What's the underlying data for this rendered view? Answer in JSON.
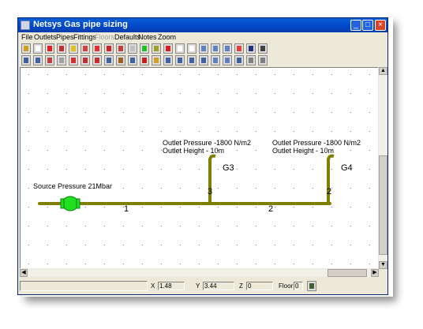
{
  "window": {
    "title": "Netsys Gas pipe sizing",
    "controls": {
      "minimize": "_",
      "maximize": "□",
      "close": "×"
    }
  },
  "menu": {
    "items": [
      {
        "label": "File",
        "enabled": true
      },
      {
        "label": "Outlets",
        "enabled": true
      },
      {
        "label": "Pipes",
        "enabled": true
      },
      {
        "label": "Fittings",
        "enabled": true
      },
      {
        "label": "Floors",
        "enabled": false
      },
      {
        "label": "Defaults",
        "enabled": true
      },
      {
        "label": "Notes",
        "enabled": true
      },
      {
        "label": "Zoom",
        "enabled": true
      }
    ]
  },
  "toolbar1": [
    {
      "icon": "pointer-icon",
      "color": "#d0a020"
    },
    {
      "icon": "new-icon",
      "color": "#ffffff"
    },
    {
      "icon": "delete-icon",
      "color": "#e02020"
    },
    {
      "icon": "boiler-icon",
      "color": "#c03030"
    },
    {
      "icon": "pen-icon",
      "color": "#e0c020"
    },
    {
      "icon": "cooker-icon",
      "color": "#d04040"
    },
    {
      "icon": "fire-icon",
      "color": "#e03030"
    },
    {
      "icon": "table-icon",
      "color": "#d02020"
    },
    {
      "icon": "grid-icon",
      "color": "#c04040"
    },
    {
      "icon": "copy-icon",
      "color": "#c0c0c0"
    },
    {
      "icon": "circle-icon",
      "color": "#20c020"
    },
    {
      "icon": "save-icon",
      "color": "#a0a020"
    },
    {
      "icon": "link-icon",
      "color": "#d02020"
    },
    {
      "icon": "page-icon",
      "color": "#ffffff"
    },
    {
      "icon": "pages-icon",
      "color": "#ffffff"
    },
    {
      "icon": "zoom-in-icon",
      "color": "#6080c0"
    },
    {
      "icon": "zoom-out-icon",
      "color": "#6080c0"
    },
    {
      "icon": "zoom-fit-icon",
      "color": "#6080c0"
    },
    {
      "icon": "route-icon",
      "color": "#e04040"
    },
    {
      "icon": "disk-icon",
      "color": "#203080"
    },
    {
      "icon": "flag-icon",
      "color": "#404040"
    }
  ],
  "toolbar2": [
    {
      "icon": "select-icon",
      "color": "#4060a0"
    },
    {
      "icon": "valve-icon",
      "color": "#4060a0"
    },
    {
      "icon": "meter-icon",
      "color": "#c04040"
    },
    {
      "icon": "tee-icon",
      "color": "#a0a0a0"
    },
    {
      "icon": "elbow-icon",
      "color": "#d03030"
    },
    {
      "icon": "bend-icon",
      "color": "#c03030"
    },
    {
      "icon": "cross-icon",
      "color": "#c03030"
    },
    {
      "icon": "reducer-icon",
      "color": "#4060a0"
    },
    {
      "icon": "riser-icon",
      "color": "#a06020"
    },
    {
      "icon": "label-icon",
      "color": "#4060a0"
    },
    {
      "icon": "remove-icon",
      "color": "#c02020"
    },
    {
      "icon": "search-icon",
      "color": "#d0a020"
    },
    {
      "icon": "print-icon",
      "color": "#4060a0"
    },
    {
      "icon": "report-icon",
      "color": "#4060a0"
    },
    {
      "icon": "doc-icon",
      "color": "#4060a0"
    },
    {
      "icon": "list-icon",
      "color": "#4060a0"
    },
    {
      "icon": "zoom-icon",
      "color": "#6080c0"
    },
    {
      "icon": "zoom-minus-icon",
      "color": "#6080c0"
    },
    {
      "icon": "frame-icon",
      "color": "#4060a0"
    },
    {
      "icon": "export-icon",
      "color": "#808080"
    },
    {
      "icon": "help-icon",
      "color": "#808080"
    }
  ],
  "diagram": {
    "source_label": "Source Pressure 21Mbar",
    "pipe_color": "#808000",
    "source_color": "#20e020",
    "pipes": [
      {
        "number": "1"
      },
      {
        "number": "2"
      },
      {
        "number": "3"
      },
      {
        "number": "2"
      }
    ],
    "outlets": [
      {
        "name": "G3",
        "pressure_label": "Outlet Pressure -1800 N/m2",
        "height_label": "Outlet Height - 10m"
      },
      {
        "name": "G4",
        "pressure_label": "Outlet Pressure -1800 N/m2",
        "height_label": "Outlet Height - 10m"
      }
    ]
  },
  "statusbar": {
    "x_label": "X",
    "x_value": "1.48",
    "y_label": "Y",
    "y_value": "3.44",
    "z_label": "Z",
    "z_value": "0",
    "floor_label": "Floor",
    "floor_value": "0"
  }
}
